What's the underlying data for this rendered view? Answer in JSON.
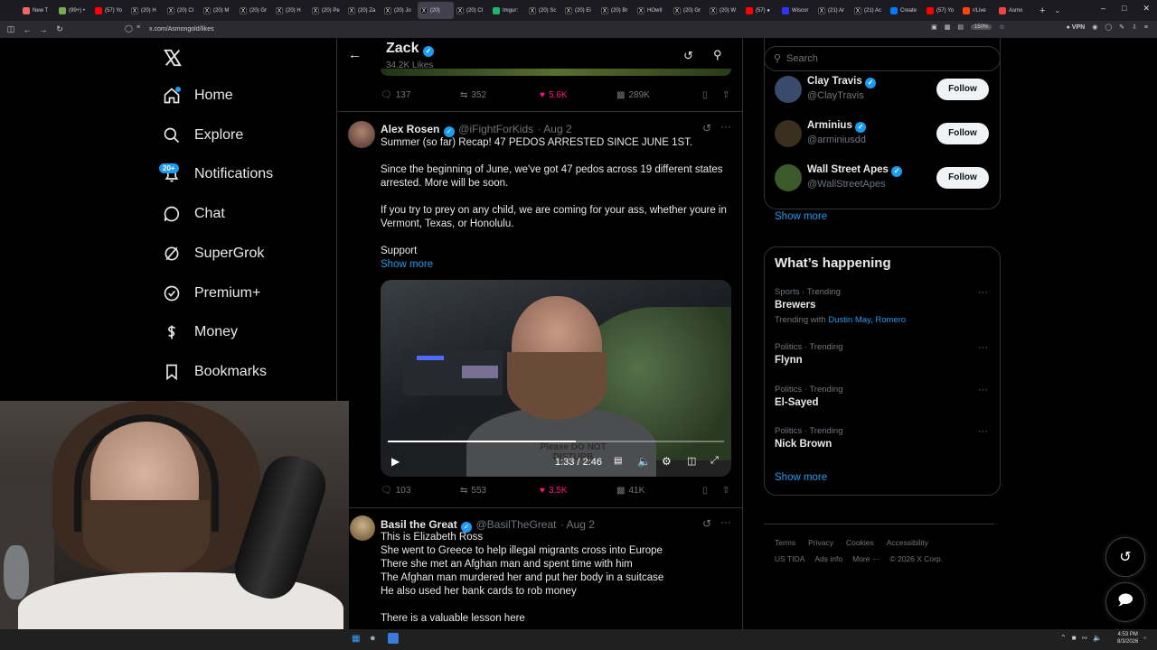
{
  "browser": {
    "tabs": [
      {
        "label": "New T",
        "fav": "#e66",
        "icon": "firefox-icon"
      },
      {
        "label": "(99+) •",
        "fav": "#7a5",
        "icon": "proton-icon"
      },
      {
        "label": "(57) Yo",
        "fav": "#f00",
        "icon": "youtube-icon"
      },
      {
        "label": "(20) H",
        "fav": "#000",
        "icon": "x-icon"
      },
      {
        "label": "(20) Cl",
        "fav": "#000",
        "icon": "x-icon"
      },
      {
        "label": "(20) M",
        "fav": "#000",
        "icon": "x-icon"
      },
      {
        "label": "(20) Gr",
        "fav": "#000",
        "icon": "x-icon"
      },
      {
        "label": "(20) H",
        "fav": "#000",
        "icon": "x-icon"
      },
      {
        "label": "(20) Pe",
        "fav": "#000",
        "icon": "x-icon"
      },
      {
        "label": "(20) Za",
        "fav": "#000",
        "icon": "x-icon"
      },
      {
        "label": "(20) Jo",
        "fav": "#000",
        "icon": "x-icon"
      },
      {
        "label": "(20) ",
        "fav": "#000",
        "icon": "x-icon",
        "active": true
      },
      {
        "label": "(20) Cl",
        "fav": "#000",
        "icon": "x-icon"
      },
      {
        "label": "Imgur:",
        "fav": "#1bb76e",
        "icon": "imgur-icon"
      },
      {
        "label": "(20) Sc",
        "fav": "#000",
        "icon": "x-icon"
      },
      {
        "label": "(20) Ei",
        "fav": "#000",
        "icon": "x-icon"
      },
      {
        "label": "(20) Br",
        "fav": "#000",
        "icon": "x-icon"
      },
      {
        "label": "HOwII",
        "fav": "#000",
        "icon": "x-icon"
      },
      {
        "label": "(20) Gr",
        "fav": "#000",
        "icon": "x-icon"
      },
      {
        "label": "(20) W",
        "fav": "#000",
        "icon": "x-icon"
      },
      {
        "label": "(57) ●",
        "fav": "#f00",
        "icon": "youtube-icon"
      },
      {
        "label": "Wiscor",
        "fav": "#33f",
        "icon": "site-icon"
      },
      {
        "label": "(21) Ar",
        "fav": "#000",
        "icon": "x-icon"
      },
      {
        "label": "(21) Ac",
        "fav": "#000",
        "icon": "x-icon"
      },
      {
        "label": "Create",
        "fav": "#07f",
        "icon": "site-icon"
      },
      {
        "label": "(57) Yo",
        "fav": "#f00",
        "icon": "youtube-icon"
      },
      {
        "label": "r/Live",
        "fav": "#ff4500",
        "icon": "reddit-icon"
      },
      {
        "label": "Asmo",
        "fav": "#e44",
        "icon": "site-icon"
      }
    ],
    "url": "x.com/Asmongold/likes",
    "zoom": "150%",
    "vpn": "VPN"
  },
  "left_nav": {
    "items": [
      {
        "label": "Home",
        "icon": "home-icon"
      },
      {
        "label": "Explore",
        "icon": "search-icon"
      },
      {
        "label": "Notifications",
        "icon": "bell-icon"
      },
      {
        "label": "Chat",
        "icon": "chat-icon"
      },
      {
        "label": "SuperGrok",
        "icon": "grok-icon"
      },
      {
        "label": "Premium+",
        "icon": "verified-icon"
      },
      {
        "label": "Money",
        "icon": "money-icon"
      },
      {
        "label": "Bookmarks",
        "icon": "bookmark-icon"
      }
    ],
    "notif_badge": "20+"
  },
  "header": {
    "name": "Zack",
    "likes": "34.2K Likes"
  },
  "tweet0_actions": {
    "replies": "137",
    "retweets": "352",
    "likes": "5.6K",
    "views": "289K"
  },
  "tweet1": {
    "name": "Alex Rosen",
    "handle": "@iFightForKids",
    "date": "· Aug 2",
    "lines": [
      "Summer (so far) Recap! 47 PEDOS ARRESTED SINCE JUNE 1ST.",
      "Since the beginning of June, we've got 47 pedos across 19 different states",
      "arrested. More will be soon.",
      "If you try to prey on any child, we are coming for your ass, whether youre in",
      "Vermont, Texas, or Honolulu.",
      "Support"
    ],
    "show_more": "Show more",
    "video_time": "1:33 / 2:46",
    "video_progress": 0.56,
    "shirt_text": "Please DO NOT DISTURB",
    "actions": {
      "replies": "103",
      "retweets": "553",
      "likes": "3.5K",
      "views": "41K"
    }
  },
  "tweet2": {
    "name": "Basil the Great",
    "handle": "@BasilTheGreat",
    "date": "· Aug 2",
    "lines": [
      "This is Elizabeth Ross",
      "She went to Greece to help illegal migrants cross into Europe",
      "There she met an Afghan man and spent time with him",
      "The Afghan man murdered her and put her body in a suitcase",
      "He also used her bank cards to rob money",
      "There is a valuable lesson here"
    ]
  },
  "right": {
    "search_placeholder": "Search",
    "who_to_follow": [
      {
        "name": "Clay Travis",
        "handle": "@ClayTravis",
        "follow": "Follow",
        "color": "#3a4a6a"
      },
      {
        "name": "Arminius",
        "handle": "@arminiusdd",
        "follow": "Follow",
        "color": "#3a3020"
      },
      {
        "name": "Wall Street Apes",
        "handle": "@WallStreetApes",
        "follow": "Follow",
        "color": "#3b5a2a"
      }
    ],
    "show_more_1": "Show more",
    "whats_happening_title": "What’s happening",
    "trends": [
      {
        "category": "Sports · Trending",
        "name": "Brewers",
        "with_label": "Trending with",
        "with_names": "Dustin May, Romero"
      },
      {
        "category": "Politics · Trending",
        "name": "Flynn"
      },
      {
        "category": "Politics · Trending",
        "name": "El-Sayed"
      },
      {
        "category": "Politics · Trending",
        "name": "Nick Brown"
      }
    ],
    "show_more_2": "Show more",
    "footer": {
      "row1": [
        "Terms",
        "Privacy",
        "Cookies",
        "Accessibility"
      ],
      "row2": [
        "US TIDA",
        "Ads info",
        "More ···",
        "© 2026 X Corp."
      ]
    }
  },
  "taskbar": {
    "time": "4:53 PM",
    "date": "8/3/2026"
  }
}
